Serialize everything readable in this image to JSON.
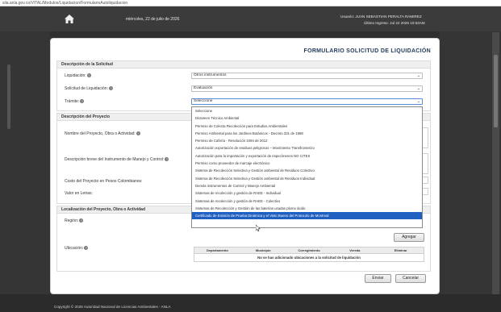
{
  "browser": {
    "url": "sila.anla.gov.co/VITAL/Modulos/Liquidacion/FormularioAutoliquidacion"
  },
  "header": {
    "date": "miércoles, 22 de julio de 2026",
    "user": "Usuario: JUAN SEBASTIAN PERALTA RAMIREZ",
    "last_login": "Último Ingreso: Jul 22 2026 10:53AM"
  },
  "form": {
    "title": "FORMULARIO SOLICITUD DE LIQUIDACIÓN"
  },
  "solicitud": {
    "heading": "Descripción de la Solicitud",
    "liquidacion_label": "Liquidación:",
    "liquidacion_value": "Otros instrumentos",
    "solicitud_label": "Solicitud de Liquidación:",
    "solicitud_value": "Evaluación",
    "tramite_label": "Trámite:",
    "tramite_value": "Seleccione"
  },
  "tramite_options": [
    "Seleccione",
    "Dictamen Técnico Ambiental",
    "Permiso de Colecta Recolección para Estudios Ambientales",
    "Permiso Ambiental para los Jardines Botánicos - Decreto 331 de 1998",
    "Permiso de Cafería - Resolución 3494 de 2012",
    "Autorización exportación de residuos peligrosos – Movimiento Transfronterizo",
    "Autorización para la importación y exportación de especímenes NO CITES",
    "Permiso como proveedor de marcaje electrónico",
    "Sistema de Recolección Selectiva y Gestión ambiental de Residuos Colectivo",
    "Sistema de Recolección Selectiva y Gestión ambiental de Residuos Individual",
    "Demás instrumentos de Control y Manejo Ambiental",
    "Sistemas de recolección y gestión de RAEE - Individual",
    "Sistemas de recolección y gestión de RAEE - Colectivo",
    "Sistemas de Recolección y Gestión de las baterías usadas plomo ácido",
    "Certificado de Emisión de Prueba Dinámica y el Visto Bueno del Protocolo de Montreal"
  ],
  "proyecto": {
    "heading": "Descripción del Proyecto",
    "nombre_label": "Nombre del Proyecto, Obra o Actividad:",
    "instrumento_label": "Descripción breve del Instrumento de Manejo y Control:",
    "costo_label": "Costo del Proyecto en Pesos Colombianos:",
    "letras_label": "Valor en Letras:"
  },
  "localizacion": {
    "heading": "Localización del Proyecto, Obra o Actividad",
    "region_label": "Región:",
    "ubicacion_label": "Ubicación:",
    "add_button": "Agregar",
    "columns": [
      "Departamento",
      "Municipio",
      "Corregimiento",
      "Vereda",
      "Eliminar"
    ],
    "empty_message": "No se han adicionado ubicaciones a la solicitud de liquidación"
  },
  "actions": {
    "send": "Enviar",
    "cancel": "Cancelar"
  },
  "footer": {
    "copyright": "Copyright © 2026 Autoridad Nacional de Licencias Ambientales - ANLA"
  },
  "colors": {
    "selected_option": "#1e5fbf",
    "title": "#1f3a5c",
    "topbar": "#3b3b3b"
  },
  "icons": {
    "home": "home-icon",
    "help": "help-icon",
    "chevron": "chevron-down-icon",
    "cursor": "mouse-cursor-icon"
  }
}
